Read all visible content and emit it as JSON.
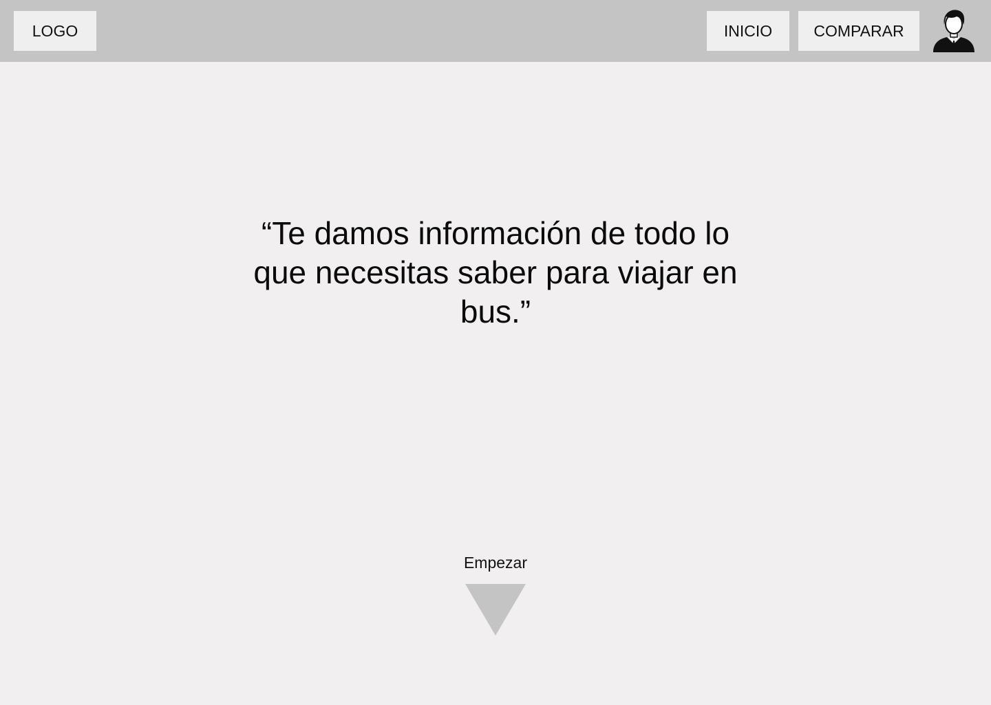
{
  "header": {
    "logo_label": "LOGO",
    "nav": {
      "inicio_label": "INICIO",
      "comparar_label": "COMPARAR"
    },
    "avatar_icon": "user-avatar-icon"
  },
  "hero": {
    "tagline": "“Te damos información de todo lo que necesitas saber para viajar en bus.”"
  },
  "cta": {
    "label": "Empezar",
    "icon": "triangle-down-icon"
  },
  "colors": {
    "header_bg": "#c4c4c4",
    "page_bg": "#f1eff0",
    "button_bg": "#efefef",
    "arrow": "#c4c4c4"
  }
}
